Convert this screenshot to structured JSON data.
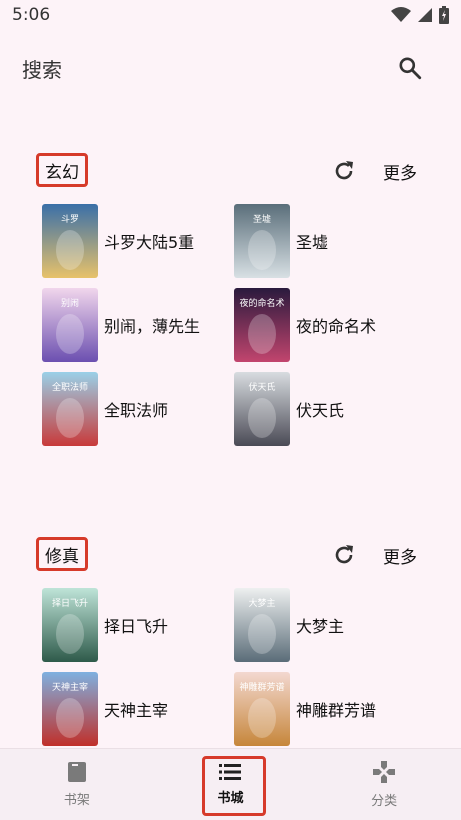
{
  "status": {
    "time": "5:06"
  },
  "app_bar": {
    "title": "搜索"
  },
  "sections": [
    {
      "title": "玄幻",
      "more_label": "更多",
      "books": [
        {
          "title": "斗罗大陆5重",
          "cover_colors": [
            "#3a6fa8",
            "#e8c26a"
          ],
          "cover_text": "斗罗"
        },
        {
          "title": "圣墟",
          "cover_colors": [
            "#5a6e7a",
            "#d8e0e4"
          ],
          "cover_text": "圣墟"
        },
        {
          "title": "别闹，薄先生",
          "cover_colors": [
            "#f1d6ec",
            "#6b4fb0"
          ],
          "cover_text": "别闹"
        },
        {
          "title": "夜的命名术",
          "cover_colors": [
            "#2a1a3d",
            "#c2456e"
          ],
          "cover_text": "夜的命名术"
        },
        {
          "title": "全职法师",
          "cover_colors": [
            "#9ad0e8",
            "#c83a3a"
          ],
          "cover_text": "全职法师"
        },
        {
          "title": "伏天氏",
          "cover_colors": [
            "#d8dce0",
            "#4a4a55"
          ],
          "cover_text": "伏天氏"
        }
      ]
    },
    {
      "title": "修真",
      "more_label": "更多",
      "books": [
        {
          "title": "择日飞升",
          "cover_colors": [
            "#bfe4d8",
            "#2e5a4a"
          ],
          "cover_text": "择日飞升"
        },
        {
          "title": "大梦主",
          "cover_colors": [
            "#eef0f0",
            "#5a6c78"
          ],
          "cover_text": "大梦主"
        },
        {
          "title": "天神主宰",
          "cover_colors": [
            "#7fb0e0",
            "#c0302a"
          ],
          "cover_text": "天神主宰"
        },
        {
          "title": "神雕群芳谱",
          "cover_colors": [
            "#f3d8d0",
            "#c6863a"
          ],
          "cover_text": "神雕群芳谱"
        }
      ]
    }
  ],
  "bottom_nav": {
    "items": [
      {
        "label": "书架",
        "icon": "book-icon"
      },
      {
        "label": "书城",
        "icon": "list-icon"
      },
      {
        "label": "分类",
        "icon": "category-icon"
      }
    ],
    "active_index": 1
  },
  "colors": {
    "accent_outline": "#d63a2a",
    "background": "#fdf3f8"
  }
}
